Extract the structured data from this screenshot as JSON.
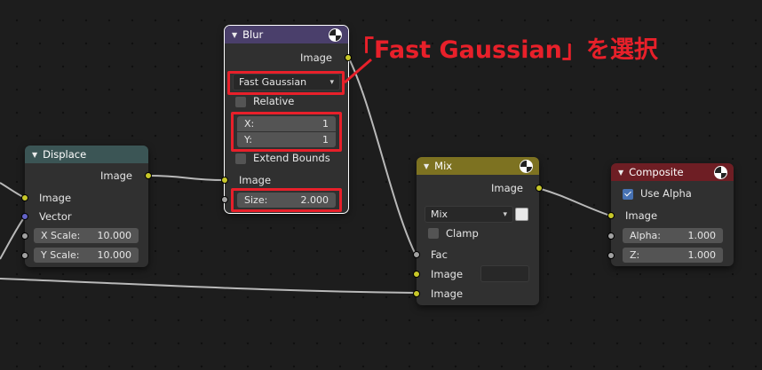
{
  "annotation": {
    "callout": "「Fast Gaussian」を選択"
  },
  "colors": {
    "accent_red": "#e8202a",
    "header_blur": "#4a3f6b",
    "header_displace": "#3b5555",
    "header_mix": "#7d7221",
    "header_composite": "#6e1e24",
    "socket_color": "#c7c729",
    "socket_float": "#a1a1a1",
    "socket_vector": "#6363c7"
  },
  "nodes": {
    "blur": {
      "title": "Blur",
      "output_image": "Image",
      "filter_type": "Fast Gaussian",
      "relative_label": "Relative",
      "x_label": "X:",
      "x_value": "1",
      "y_label": "Y:",
      "y_value": "1",
      "extend_bounds_label": "Extend Bounds",
      "input_image": "Image",
      "size_label": "Size:",
      "size_value": "2.000"
    },
    "displace": {
      "title": "Displace",
      "output_image": "Image",
      "input_image": "Image",
      "input_vector": "Vector",
      "xscale_label": "X Scale:",
      "xscale_value": "10.000",
      "yscale_label": "Y Scale:",
      "yscale_value": "10.000"
    },
    "mix": {
      "title": "Mix",
      "output_image": "Image",
      "blend_mode": "Mix",
      "clamp_label": "Clamp",
      "fac_label": "Fac",
      "image1_label": "Image",
      "image2_label": "Image"
    },
    "composite": {
      "title": "Composite",
      "use_alpha_label": "Use Alpha",
      "input_image": "Image",
      "alpha_label": "Alpha:",
      "alpha_value": "1.000",
      "z_label": "Z:",
      "z_value": "1.000"
    }
  }
}
